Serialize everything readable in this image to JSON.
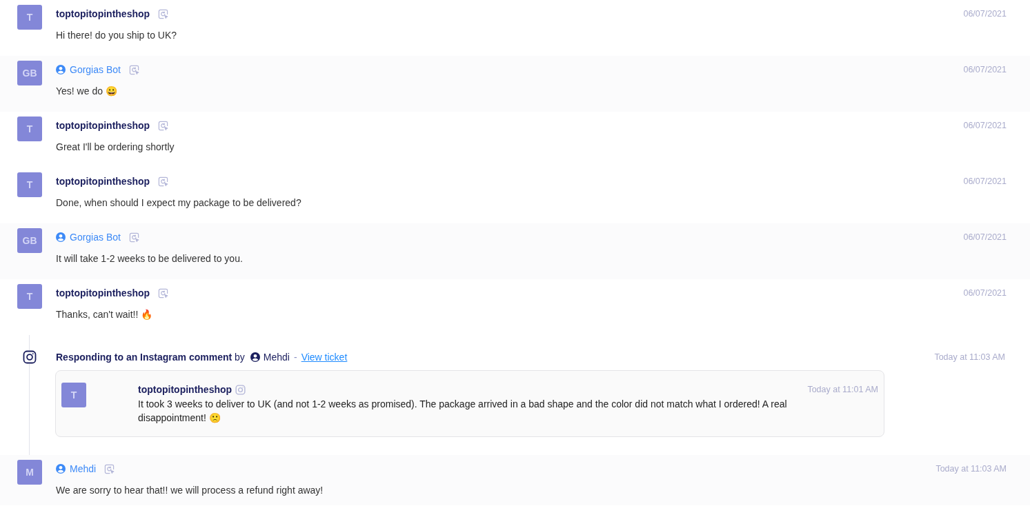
{
  "messages": [
    {
      "kind": "customer",
      "initials": "T",
      "sender": "toptopitopintheshop",
      "date": "06/07/2021",
      "text": "Hi there! do you ship to UK?"
    },
    {
      "kind": "agent",
      "initials": "GB",
      "sender": "Gorgias Bot",
      "date": "06/07/2021",
      "text": "Yes! we do 😀"
    },
    {
      "kind": "customer",
      "initials": "T",
      "sender": "toptopitopintheshop",
      "date": "06/07/2021",
      "text": "Great I'll be ordering shortly"
    },
    {
      "kind": "customer",
      "initials": "T",
      "sender": "toptopitopintheshop",
      "date": "06/07/2021",
      "text": "Done, when should I expect my package to be delivered?"
    },
    {
      "kind": "agent",
      "initials": "GB",
      "sender": "Gorgias Bot",
      "date": "06/07/2021",
      "text": "It will take 1-2 weeks to be delivered to you."
    },
    {
      "kind": "customer",
      "initials": "T",
      "sender": "toptopitopintheshop",
      "date": "06/07/2021",
      "text": "Thanks, can't wait!! 🔥"
    }
  ],
  "event": {
    "header": "**Responding to an Instagram comment** by",
    "agent": "Mehdi",
    "separator": "-",
    "link": "View ticket",
    "date": "Today at 11:03 AM",
    "comment": {
      "initials": "T",
      "sender": "toptopitopintheshop",
      "date": "Today at 11:01 AM",
      "text": "It took 3 weeks to deliver to UK (and not 1-2 weeks as promised). The package arrived in a bad shape and the color did not match what I ordered! A real disappointment! 🙁"
    }
  },
  "reply": {
    "kind": "agent",
    "initials": "M",
    "sender": "Mehdi",
    "date": "Today at 11:03 AM",
    "text": "We are sorry to hear that!! we will process a refund right away!"
  }
}
